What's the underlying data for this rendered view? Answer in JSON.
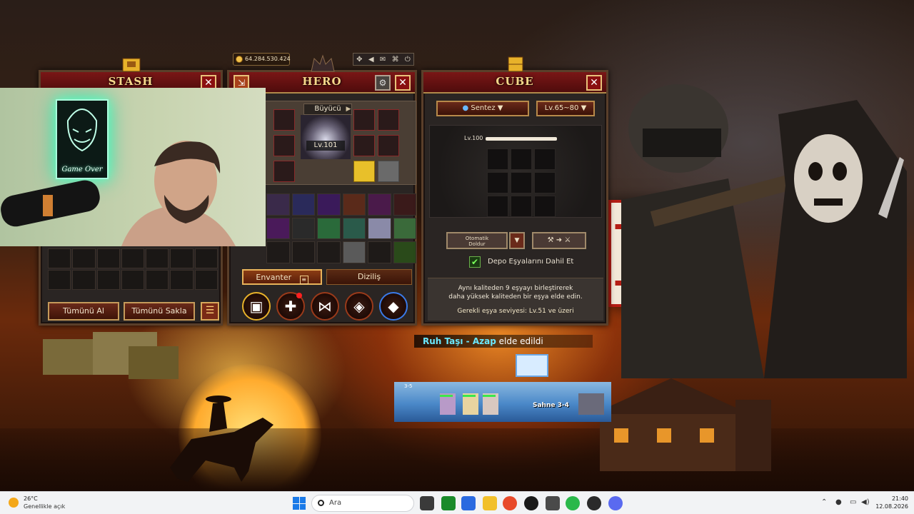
{
  "stash": {
    "title": "Stash",
    "take_all_label": "Tümünü Al",
    "hide_all_label": "Tümünü Sakla"
  },
  "hero": {
    "title": "Hero",
    "gold": "64.284.530.424",
    "class_name": "Büyücü",
    "level": "Lv.101",
    "tab_inventory": "Envanter",
    "tab_lineup": "Diziliş"
  },
  "cube": {
    "title": "Cube",
    "mode_select": "Sentez",
    "level_select": "Lv.65~80",
    "lv_label": "Lv.100",
    "auto_fill_label_1": "Otomatik",
    "auto_fill_label_2": "Doldur",
    "include_stash_label": "Depo Eşyalarını Dahil Et",
    "include_stash_checked": true,
    "info_line_1": "Aynı kaliteden 9 eşyayı birleştirerek",
    "info_line_2": "daha yüksek kaliteden bir eşya elde edin.",
    "required_level": "Gerekli eşya seviyesi: Lv.51 ve üzeri"
  },
  "webcam": {
    "neon_text": "Game Over"
  },
  "battle": {
    "notification_item": "Ruh Taşı - Azap",
    "notification_rest": " elde edildi",
    "stage_small": "3-5",
    "stage_name": "Sahne 3-4"
  },
  "colors": {
    "header_red": "#7a1616",
    "gold_text": "#f7d88a",
    "accent_cyan": "#6ae8ff"
  },
  "taskbar": {
    "weather_temp": "26°C",
    "weather_desc": "Genellikle açık",
    "search_placeholder": "Ara",
    "time": "21:40",
    "date": "12.08.2026"
  }
}
